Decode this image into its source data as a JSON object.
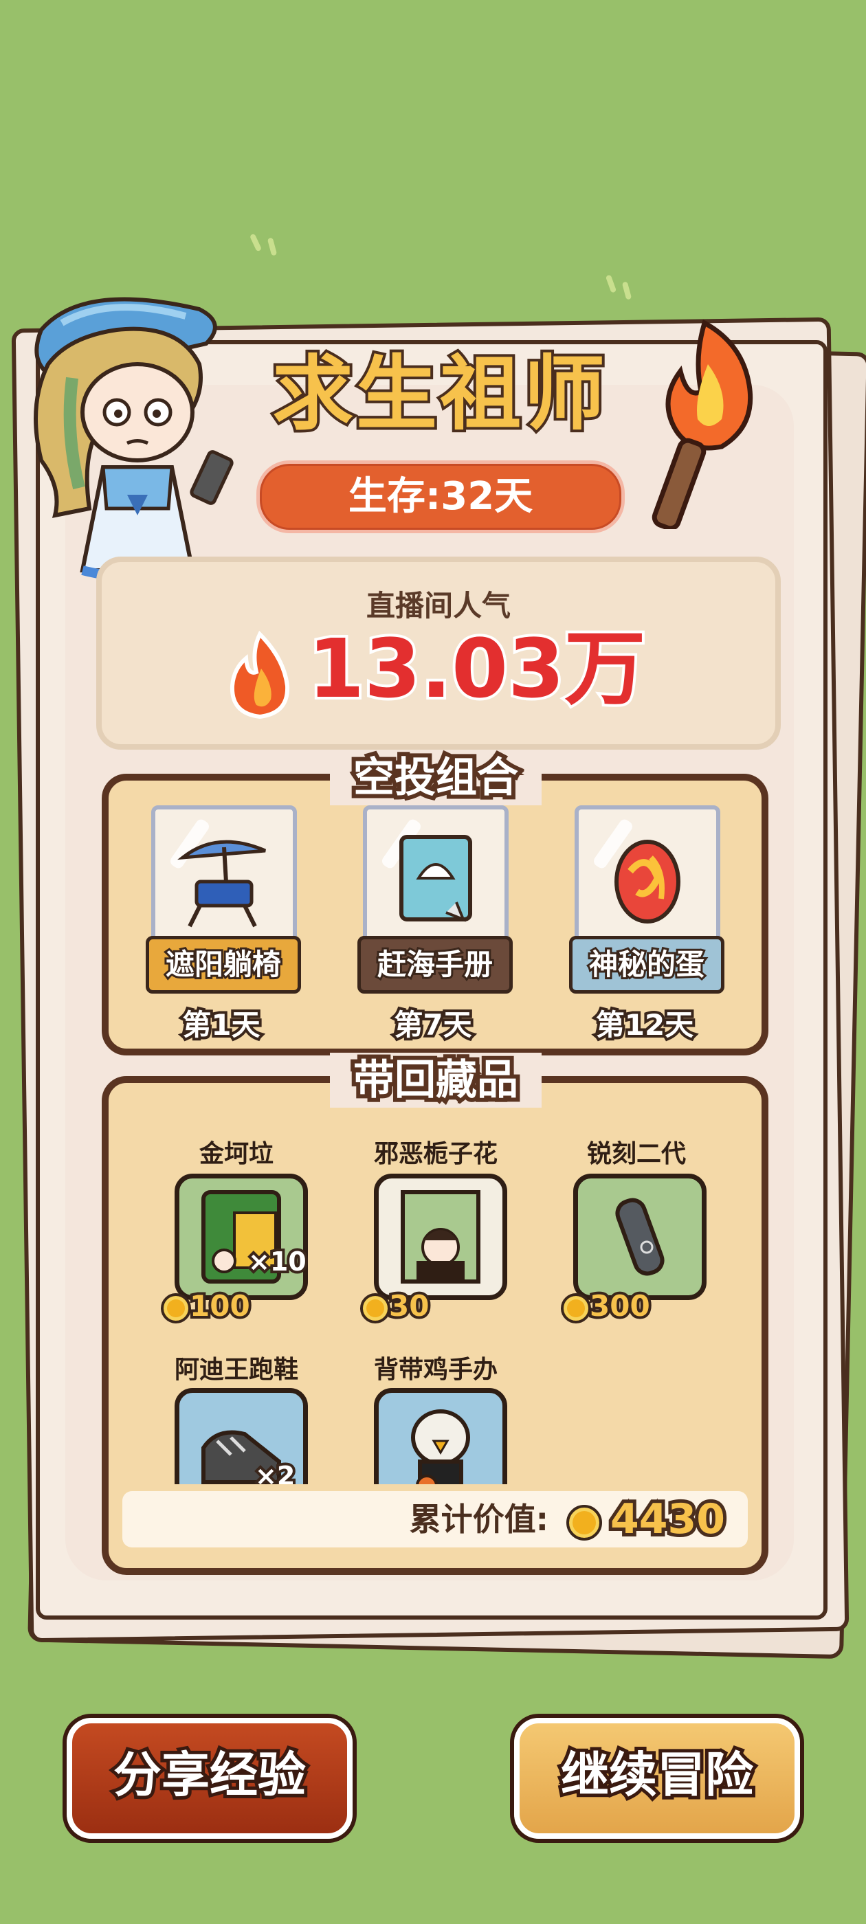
{
  "header": {
    "title": "求生祖师",
    "survival": "生存:32天"
  },
  "popularity": {
    "label": "直播间人气",
    "value": "13.03万"
  },
  "airdrop": {
    "section_title": "空投组合",
    "items": [
      {
        "name": "遮阳躺椅",
        "day": "第1天",
        "icon": "beach-chair-icon",
        "label_color": "#e8a83c"
      },
      {
        "name": "赶海手册",
        "day": "第7天",
        "icon": "handbook-icon",
        "label_color": "#6b4a3a"
      },
      {
        "name": "神秘的蛋",
        "day": "第12天",
        "icon": "mystery-egg-icon",
        "label_color": "#9fc3d6"
      }
    ]
  },
  "collection": {
    "section_title": "带回藏品",
    "items": [
      {
        "name": "金坷垃",
        "price": "100",
        "qty": "×10",
        "icon": "fertilizer-bag-icon",
        "bg": "#a9c98f"
      },
      {
        "name": "邪恶栀子花",
        "price": "30",
        "icon": "book-cover-icon",
        "bg": "#f3eee2"
      },
      {
        "name": "锐刻二代",
        "price": "300",
        "icon": "e-cigarette-icon",
        "bg": "#a9c98f"
      },
      {
        "name": "阿迪王跑鞋",
        "qty": "×2",
        "icon": "sneakers-icon",
        "bg": "#9fc9e0"
      },
      {
        "name": "背带鸡手办",
        "icon": "chicken-figure-icon",
        "bg": "#9fc9e0"
      }
    ],
    "total_label": "累计价值:",
    "total_value": "4430"
  },
  "buttons": {
    "share": "分享经验",
    "continue": "继续冒险"
  },
  "colors": {
    "background": "#98c06a",
    "title_fill": "#f7c24c",
    "popularity_red": "#e32f2f",
    "panel_fill": "#f4d9a8",
    "outline_brown": "#5a3421"
  }
}
